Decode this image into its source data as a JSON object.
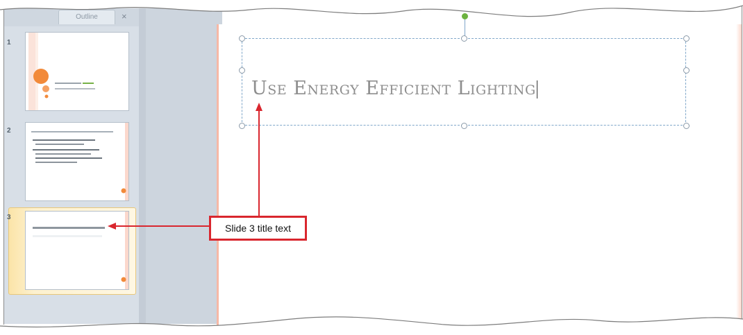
{
  "panel": {
    "tab_label": "Outline",
    "close_glyph": "×",
    "slides": [
      {
        "number": "1"
      },
      {
        "number": "2"
      },
      {
        "number": "3"
      }
    ]
  },
  "slide": {
    "title": "Use Energy Efficient Lighting"
  },
  "callout": {
    "label": "Slide 3 title text"
  },
  "colors": {
    "callout_red": "#d9262e",
    "accent_orange": "#f28a3a",
    "rotate_green": "#6cb33f",
    "placeholder_blue": "#7fa6c9"
  },
  "icons": [
    "close-icon",
    "rotate-handle-icon",
    "sizing-handle-icon"
  ]
}
